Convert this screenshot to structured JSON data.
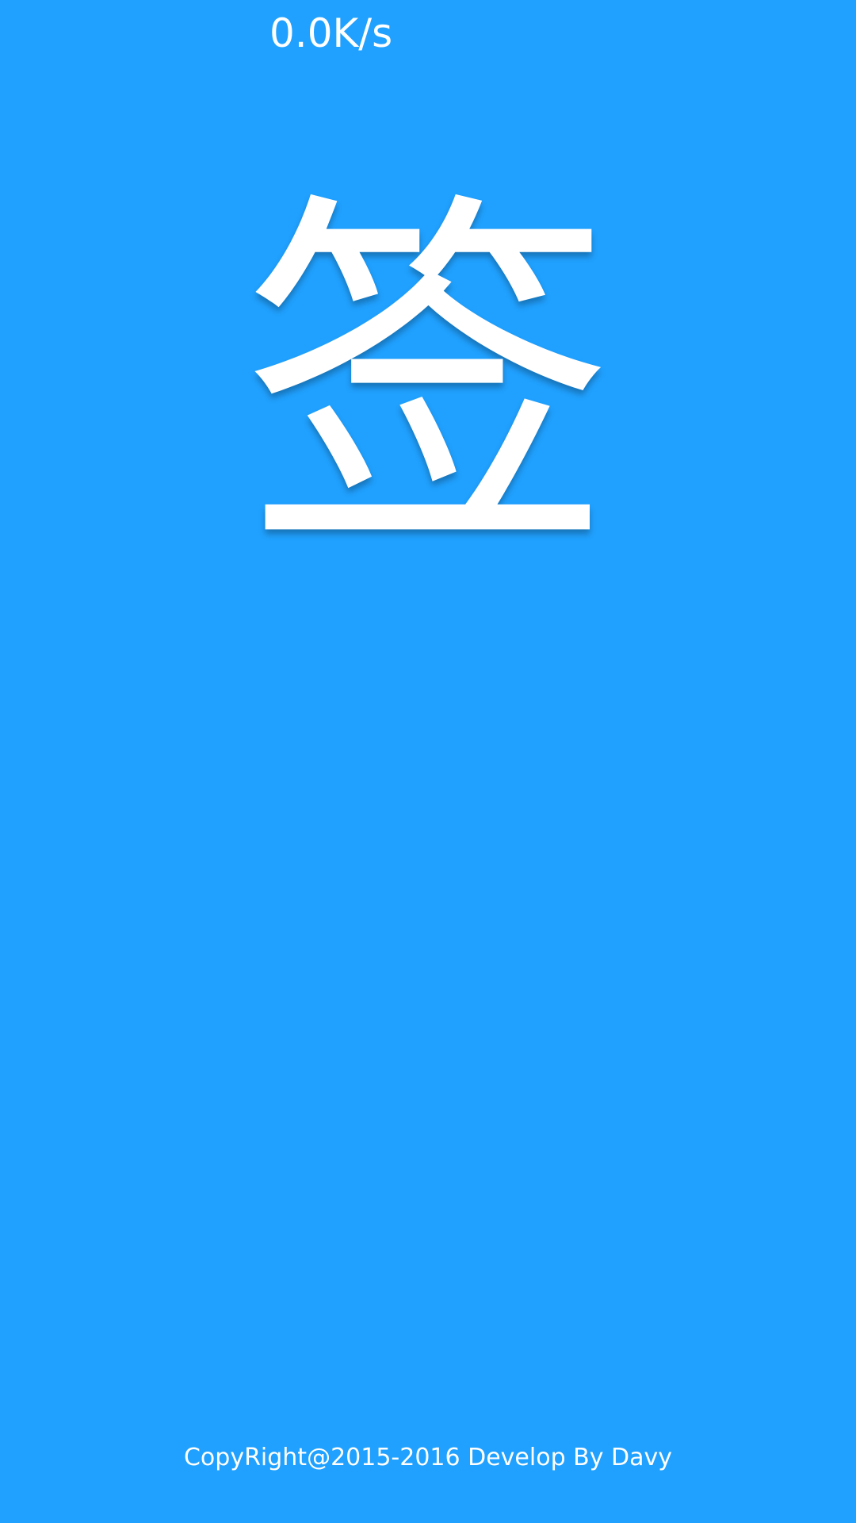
{
  "status": {
    "network_speed": "0.0K/s"
  },
  "splash": {
    "logo_text": "签",
    "background_color": "#20A1FF",
    "text_color": "#FFFFFF"
  },
  "footer": {
    "copyright": "CopyRight@2015-2016 Develop By Davy"
  }
}
